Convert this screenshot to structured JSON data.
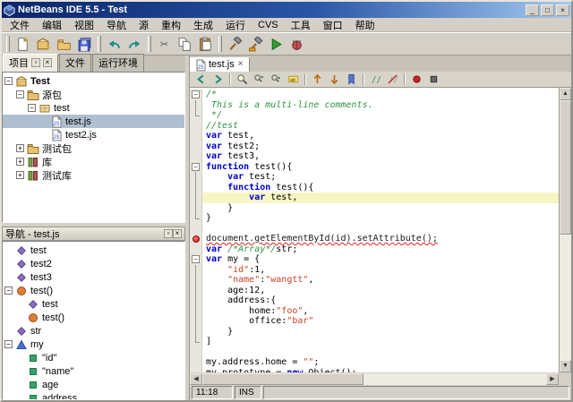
{
  "window": {
    "title": "NetBeans IDE 5.5 - Test"
  },
  "menubar": {
    "items": [
      "文件",
      "编辑",
      "视图",
      "导航",
      "源",
      "重构",
      "生成",
      "运行",
      "CVS",
      "工具",
      "窗口",
      "帮助"
    ]
  },
  "toolbar": {
    "groups": [
      [
        "new-file",
        "new-project",
        "open-project",
        "save-all"
      ],
      [
        "undo",
        "redo"
      ],
      [
        "cut",
        "copy",
        "paste"
      ],
      [
        "build-project",
        "clean-build",
        "run-project",
        "debug-project"
      ]
    ]
  },
  "projects_panel": {
    "tabs": [
      {
        "label": "项目"
      },
      {
        "label": "文件"
      },
      {
        "label": "运行环境"
      }
    ],
    "tree": [
      {
        "label": "Test",
        "level": 0,
        "expand": "minus",
        "icon": "project",
        "bold": true
      },
      {
        "label": "源包",
        "level": 1,
        "expand": "minus",
        "icon": "source-folder"
      },
      {
        "label": "test",
        "level": 2,
        "expand": "minus",
        "icon": "package"
      },
      {
        "label": "test.js",
        "level": 3,
        "icon": "js-file",
        "selected": true
      },
      {
        "label": "test2.js",
        "level": 3,
        "icon": "js-file"
      },
      {
        "label": "测试包",
        "level": 1,
        "expand": "plus",
        "icon": "source-folder"
      },
      {
        "label": "库",
        "level": 1,
        "expand": "plus",
        "icon": "libraries"
      },
      {
        "label": "测试库",
        "level": 1,
        "expand": "plus",
        "icon": "libraries"
      }
    ]
  },
  "navigator": {
    "title": "导航 - test.js",
    "tree": [
      {
        "label": "test",
        "level": 0,
        "icon": "var"
      },
      {
        "label": "test2",
        "level": 0,
        "icon": "var"
      },
      {
        "label": "test3",
        "level": 0,
        "icon": "var"
      },
      {
        "label": "test()",
        "level": 0,
        "expand": "minus",
        "icon": "function"
      },
      {
        "label": "test",
        "level": 1,
        "icon": "var"
      },
      {
        "label": "test()",
        "level": 1,
        "icon": "function"
      },
      {
        "label": "str",
        "level": 0,
        "icon": "var"
      },
      {
        "label": "my",
        "level": 0,
        "expand": "minus",
        "icon": "object"
      },
      {
        "label": "\"id\"",
        "level": 1,
        "icon": "property"
      },
      {
        "label": "\"name\"",
        "level": 1,
        "icon": "property"
      },
      {
        "label": "age",
        "level": 1,
        "icon": "property"
      },
      {
        "label": "address",
        "level": 1,
        "icon": "property"
      }
    ]
  },
  "editor_toolbar": {
    "groups": [
      [
        "back",
        "forward"
      ],
      [
        "find-selection",
        "find-next",
        "find-previous",
        "toggle-highlight"
      ],
      [
        "previous-bookmark",
        "next-bookmark",
        "toggle-bookmark"
      ],
      [
        "comment",
        "uncomment"
      ],
      [
        "start-macro",
        "stop-macro"
      ]
    ]
  },
  "editor": {
    "tab": "test.js",
    "status_position": "11:18",
    "status_mode": "INS",
    "lines": [
      {
        "f": "s",
        "t": [
          [
            "c",
            "/*"
          ]
        ]
      },
      {
        "f": "l",
        "t": [
          [
            "c",
            " This is a multi-line comments."
          ]
        ]
      },
      {
        "f": "e",
        "t": [
          [
            "c",
            " */"
          ]
        ]
      },
      {
        "t": [
          [
            "c",
            "//test"
          ]
        ]
      },
      {
        "t": [
          [
            "k",
            "var"
          ],
          [
            "p",
            " test,"
          ]
        ]
      },
      {
        "t": [
          [
            "k",
            "var"
          ],
          [
            "p",
            " test2;"
          ]
        ]
      },
      {
        "t": [
          [
            "k",
            "var"
          ],
          [
            "p",
            " test3,"
          ]
        ]
      },
      {
        "f": "s",
        "t": [
          [
            "k",
            "function"
          ],
          [
            "p",
            " test(){"
          ]
        ]
      },
      {
        "f": "l",
        "t": [
          [
            "p",
            "    "
          ],
          [
            "k",
            "var"
          ],
          [
            "p",
            " test;"
          ]
        ]
      },
      {
        "f": "l",
        "t": [
          [
            "p",
            "    "
          ],
          [
            "k",
            "function"
          ],
          [
            "p",
            " test(){"
          ]
        ]
      },
      {
        "f": "l",
        "h": true,
        "t": [
          [
            "p",
            "        "
          ],
          [
            "k",
            "var"
          ],
          [
            "p",
            " test,"
          ]
        ]
      },
      {
        "f": "l",
        "t": [
          [
            "p",
            "    }"
          ]
        ]
      },
      {
        "f": "e",
        "t": [
          [
            "p",
            "}"
          ]
        ]
      },
      {
        "t": []
      },
      {
        "err": true,
        "t": [
          [
            "u",
            "document.getElementById(id).setAttribute();"
          ]
        ]
      },
      {
        "t": [
          [
            "k",
            "var"
          ],
          [
            "p",
            " "
          ],
          [
            "c",
            "/*Array*/"
          ],
          [
            "p",
            "str;"
          ]
        ]
      },
      {
        "f": "s",
        "t": [
          [
            "k",
            "var"
          ],
          [
            "p",
            " my = {"
          ]
        ]
      },
      {
        "f": "l",
        "t": [
          [
            "p",
            "    "
          ],
          [
            "s",
            "\"id\""
          ],
          [
            "p",
            ":1,"
          ]
        ]
      },
      {
        "f": "l",
        "t": [
          [
            "p",
            "    "
          ],
          [
            "s",
            "\"name\""
          ],
          [
            "p",
            ":"
          ],
          [
            "s",
            "\"wangtt\""
          ],
          [
            "p",
            ","
          ]
        ]
      },
      {
        "f": "l",
        "t": [
          [
            "p",
            "    age:12,"
          ]
        ]
      },
      {
        "f": "l",
        "t": [
          [
            "p",
            "    address:{"
          ]
        ]
      },
      {
        "f": "l",
        "t": [
          [
            "p",
            "        home:"
          ],
          [
            "s",
            "\"foo\""
          ],
          [
            "p",
            ","
          ]
        ]
      },
      {
        "f": "l",
        "t": [
          [
            "p",
            "        office:"
          ],
          [
            "s",
            "\"bar\""
          ]
        ]
      },
      {
        "f": "l",
        "t": [
          [
            "p",
            "    }"
          ]
        ]
      },
      {
        "f": "e",
        "t": [
          [
            "p",
            "]"
          ]
        ]
      },
      {
        "t": []
      },
      {
        "t": [
          [
            "p",
            "my.address.home = "
          ],
          [
            "s",
            "\"\""
          ],
          [
            "p",
            ";"
          ]
        ]
      },
      {
        "t": [
          [
            "p",
            "my.prototype = "
          ],
          [
            "k",
            "new"
          ],
          [
            "p",
            " Object();"
          ]
        ]
      }
    ]
  },
  "colors": {
    "titlebar_start": "#0a246a",
    "titlebar_end": "#a6caf0",
    "chrome": "#d4d0c8",
    "selection": "#aebfcf",
    "current_line": "#f6f6c3",
    "error": "#dd2222",
    "keyword": "#0000cc",
    "string": "#cc4125",
    "comment": "#2f9343"
  }
}
